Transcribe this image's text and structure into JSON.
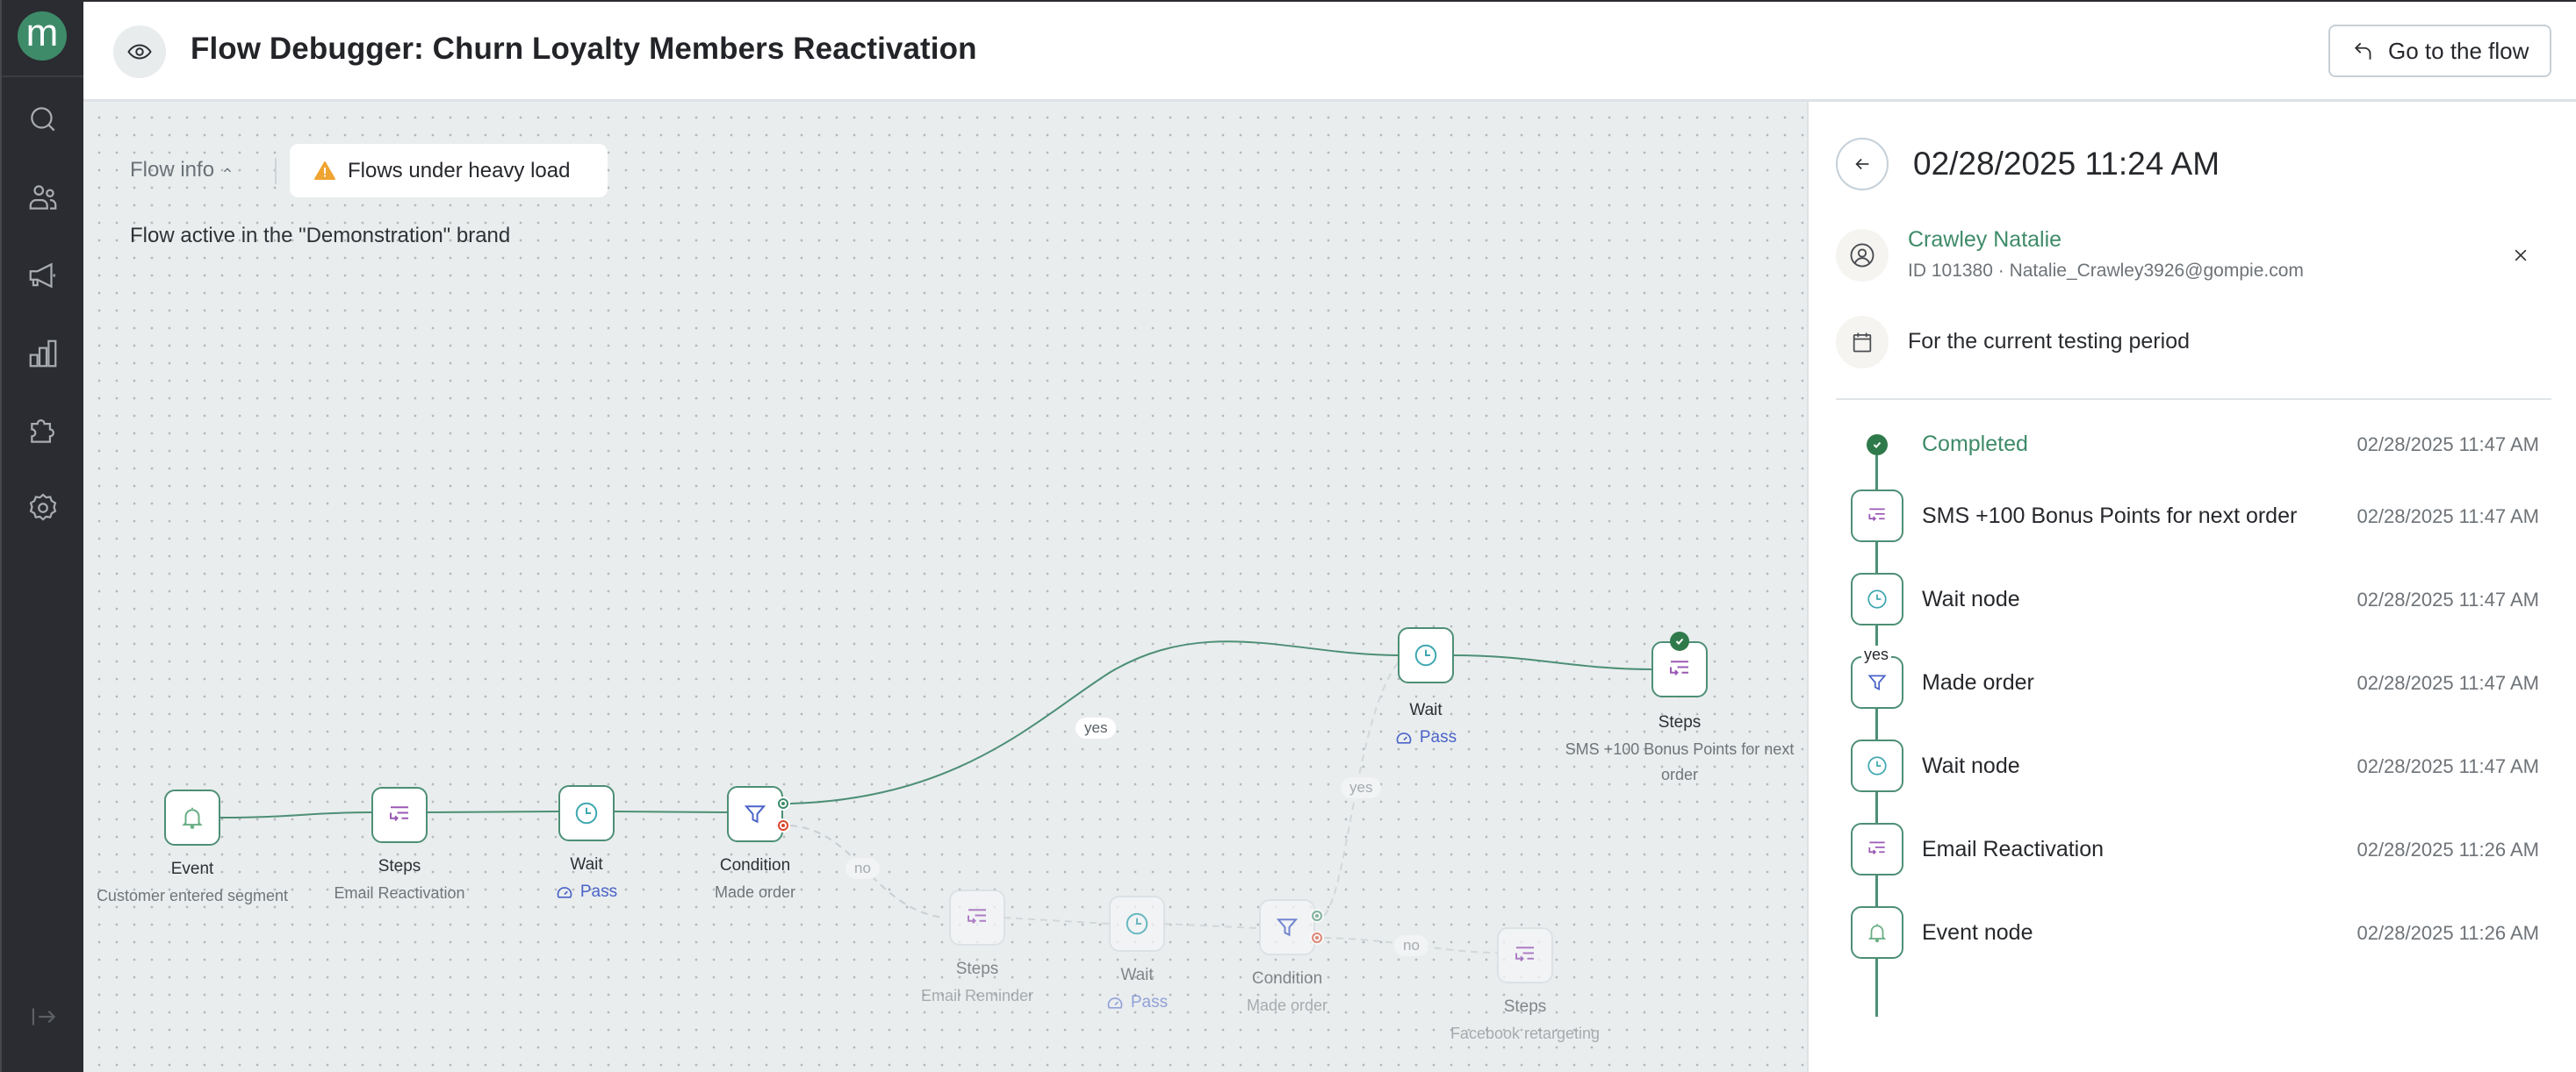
{
  "app": {
    "logo_letter": "m",
    "brand_color": "#3e8b69"
  },
  "sidebar": {
    "items": [
      {
        "icon": "search-icon",
        "label": "Search"
      },
      {
        "icon": "users-icon",
        "label": "Customers"
      },
      {
        "icon": "megaphone-icon",
        "label": "Campaigns"
      },
      {
        "icon": "bar-chart-icon",
        "label": "Analytics"
      },
      {
        "icon": "puzzle-icon",
        "label": "Integrations"
      },
      {
        "icon": "gear-icon",
        "label": "Settings"
      }
    ],
    "expand_icon": "expand-sidebar-icon"
  },
  "header": {
    "title": "Flow Debugger: Churn Loyalty Members Reactivation",
    "goto_button": "Go to the flow"
  },
  "canvas": {
    "flow_info_label": "Flow info",
    "warning_chip": "Flows under heavy load",
    "brand_note": "Flow active in the \"Demonstration\" brand",
    "nodes": [
      {
        "id": "event",
        "type": "Event",
        "subtitle": "Customer entered segment",
        "icon": "bell-icon",
        "state": "active"
      },
      {
        "id": "steps1",
        "type": "Steps",
        "subtitle": "Email Reactivation",
        "icon": "steps-icon",
        "state": "active"
      },
      {
        "id": "wait1",
        "type": "Wait",
        "subtitle": "Pass",
        "icon": "clock-icon",
        "state": "active",
        "pass": true
      },
      {
        "id": "cond1",
        "type": "Condition",
        "subtitle": "Made order",
        "icon": "filter-icon",
        "state": "active"
      },
      {
        "id": "wait2",
        "type": "Wait",
        "subtitle": "Pass",
        "icon": "clock-icon",
        "state": "active",
        "pass": true
      },
      {
        "id": "steps2",
        "type": "Steps",
        "subtitle": "SMS +100 Bonus Points for next order",
        "icon": "steps-icon",
        "state": "completed"
      },
      {
        "id": "steps3",
        "type": "Steps",
        "subtitle": "Email Reminder",
        "icon": "steps-icon",
        "state": "inactive"
      },
      {
        "id": "wait3",
        "type": "Wait",
        "subtitle": "Pass",
        "icon": "clock-icon",
        "state": "inactive",
        "pass": true
      },
      {
        "id": "cond2",
        "type": "Condition",
        "subtitle": "Made order",
        "icon": "filter-icon",
        "state": "inactive"
      },
      {
        "id": "steps4",
        "type": "Steps",
        "subtitle": "Facebook retargeting",
        "icon": "steps-icon",
        "state": "inactive"
      }
    ],
    "edge_labels": {
      "yes_main": "yes",
      "no_main": "no",
      "yes_faded": "yes",
      "no_faded": "no"
    }
  },
  "panel": {
    "title": "02/28/2025 11:24 AM",
    "customer": {
      "name": "Crawley Natalie",
      "meta": "ID 101380 · Natalie_Crawley3926@gompie.com"
    },
    "period": "For the current testing period",
    "timeline": [
      {
        "label": "Completed",
        "time": "02/28/2025 11:47 AM",
        "kind": "completed"
      },
      {
        "label": "SMS +100 Bonus Points for next order",
        "time": "02/28/2025 11:47 AM",
        "kind": "steps"
      },
      {
        "label": "Wait node",
        "time": "02/28/2025 11:47 AM",
        "kind": "wait"
      },
      {
        "label": "Made order",
        "time": "02/28/2025 11:47 AM",
        "kind": "condition",
        "branch": "yes"
      },
      {
        "label": "Wait node",
        "time": "02/28/2025 11:47 AM",
        "kind": "wait"
      },
      {
        "label": "Email Reactivation",
        "time": "02/28/2025 11:26 AM",
        "kind": "steps"
      },
      {
        "label": "Event node",
        "time": "02/28/2025 11:26 AM",
        "kind": "event"
      }
    ]
  }
}
